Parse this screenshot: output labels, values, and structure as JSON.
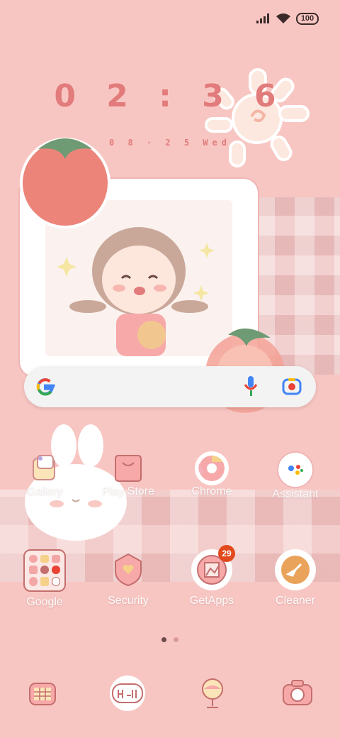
{
  "status_bar": {
    "battery": "100",
    "icons": [
      "signal-icon",
      "wifi-icon",
      "battery-icon"
    ]
  },
  "clock": {
    "time": "0 2 : 3 6",
    "date": "0 8 · 2 5  Wed"
  },
  "search": {
    "icons": [
      "google-g-icon",
      "microphone-icon",
      "lens-icon"
    ]
  },
  "apps_row1": [
    {
      "label": "Gallery"
    },
    {
      "label": "Play Store"
    },
    {
      "label": "Chrome"
    },
    {
      "label": "Assistant"
    }
  ],
  "apps_row2": [
    {
      "label": "Google"
    },
    {
      "label": "Security"
    },
    {
      "label": "GetApps",
      "badge": "29"
    },
    {
      "label": "Cleaner"
    }
  ],
  "dock": [
    "calendar-app-icon",
    "hello-app-icon",
    "globe-app-icon",
    "camera-app-icon"
  ],
  "page_indicator": {
    "pages": 2,
    "current": 1
  },
  "colors": {
    "background": "#f8c6c2",
    "accent": "#e27b7b",
    "badge": "#e24a1e"
  }
}
